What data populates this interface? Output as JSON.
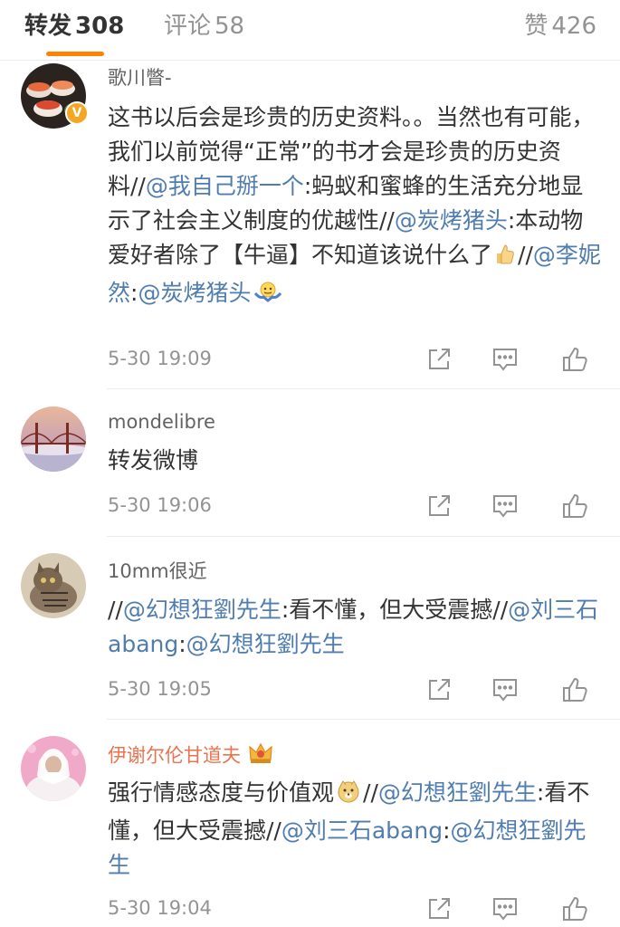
{
  "tabs": {
    "repost": {
      "label": "转发",
      "count": "308"
    },
    "comment": {
      "label": "评论",
      "count": "58"
    },
    "like": {
      "label": "赞",
      "count": "426"
    }
  },
  "items": [
    {
      "username": "歌川瞥-",
      "segments": [
        {
          "t": "这书以后会是珍贵的历史资料。。当然也有可能，我们以前觉得“正常”的书才会是珍贵的历史资料//"
        },
        {
          "t": "@我自己掰一个",
          "link": true
        },
        {
          "t": ":蚂蚁和蜜蜂的生活充分地显示了社会主义制度的优越性//"
        },
        {
          "t": "@炭烤猪头",
          "link": true
        },
        {
          "t": ":本动物爱好者除了【牛逼】不知道该说什么了"
        },
        {
          "emoji": "thumb-up-emoji"
        },
        {
          "t": "//"
        },
        {
          "t": "@李妮然",
          "link": true
        },
        {
          "t": ":"
        },
        {
          "t": "@炭烤猪头",
          "link": true
        },
        {
          "emoji": "shrug-emoji"
        }
      ],
      "time": "5-30 19:09"
    },
    {
      "username": "mondelibre",
      "segments": [
        {
          "t": "转发微博"
        }
      ],
      "time": "5-30 19:06"
    },
    {
      "username": "10mm很近",
      "segments": [
        {
          "t": "//"
        },
        {
          "t": "@幻想狂劉先生",
          "link": true
        },
        {
          "t": ":看不懂，但大受震撼//"
        },
        {
          "t": "@刘三石abang",
          "link": true
        },
        {
          "t": ":"
        },
        {
          "t": "@幻想狂劉先生",
          "link": true
        }
      ],
      "time": "5-30 19:05"
    },
    {
      "username": "伊谢尔伦甘道夫",
      "segments": [
        {
          "t": "强行情感态度与价值观"
        },
        {
          "emoji": "doge-emoji"
        },
        {
          "t": "//"
        },
        {
          "t": "@幻想狂劉先生",
          "link": true
        },
        {
          "t": ":看不懂，但大受震撼//"
        },
        {
          "t": "@刘三石abang",
          "link": true
        },
        {
          "t": ":"
        },
        {
          "t": "@幻想狂劉先生",
          "link": true
        }
      ],
      "time": "5-30 19:04"
    }
  ],
  "colors": {
    "accent": "#ff8200",
    "link": "#507daf",
    "vip_name": "#eb7350",
    "verified": "#f5a623"
  },
  "icons": [
    "share-icon",
    "comment-icon",
    "like-icon",
    "verified-badge-icon",
    "crown-icon"
  ]
}
